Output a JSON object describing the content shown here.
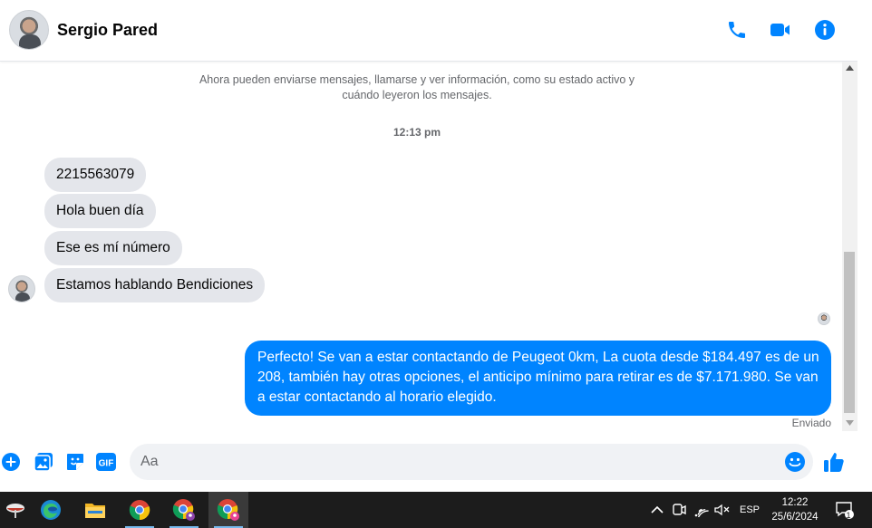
{
  "header": {
    "contact_name": "Sergio Pared",
    "actions": [
      {
        "icon": "phone-icon"
      },
      {
        "icon": "video-camera-icon"
      },
      {
        "icon": "info-icon"
      }
    ]
  },
  "conversation": {
    "system_message": "Ahora pueden enviarse mensajes, llamarse y ver información, como su estado activo y cuándo leyeron los mensajes.",
    "timestamp": "12:13 pm",
    "incoming": [
      "2215563079",
      "Hola buen día",
      "Ese es mí número",
      "Estamos hablando Bendiciones"
    ],
    "outgoing": "Perfecto! Se van a estar contactando de Peugeot 0km, La cuota desde $184.497 es de un 208, también hay otras opciones, el anticipo mínimo para retirar es de $7.171.980. Se van a estar contactando al horario elegido.",
    "status": "Enviado"
  },
  "composer": {
    "placeholder": "Aa",
    "tools": [
      "plus-icon",
      "image-icon",
      "sticker-icon",
      "gif-icon"
    ],
    "gif_label": "GIF"
  },
  "taskbar": {
    "apps": [
      "widget-icon",
      "edge-icon",
      "file-explorer-icon",
      "chrome-icon",
      "chrome-profile-icon",
      "chrome-active-icon"
    ],
    "language": "ESP",
    "time": "12:22",
    "date": "25/6/2024",
    "notifications": "1"
  },
  "colors": {
    "accent": "#0084ff",
    "incoming_bubble": "#e4e6eb",
    "taskbar": "#1c1c1c"
  }
}
